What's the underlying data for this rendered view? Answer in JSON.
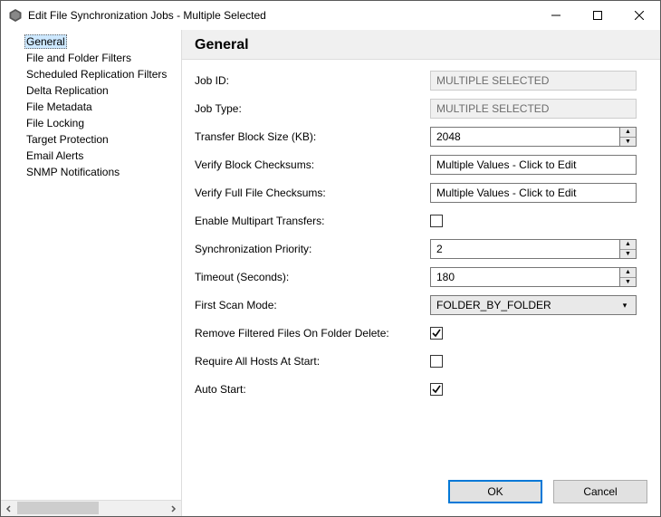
{
  "window": {
    "title": "Edit File Synchronization Jobs - Multiple Selected"
  },
  "sidebar": {
    "items": [
      {
        "label": "General",
        "selected": true
      },
      {
        "label": "File and Folder Filters",
        "selected": false
      },
      {
        "label": "Scheduled Replication Filters",
        "selected": false
      },
      {
        "label": "Delta Replication",
        "selected": false
      },
      {
        "label": "File Metadata",
        "selected": false
      },
      {
        "label": "File Locking",
        "selected": false
      },
      {
        "label": "Target Protection",
        "selected": false
      },
      {
        "label": "Email Alerts",
        "selected": false
      },
      {
        "label": "SNMP Notifications",
        "selected": false
      }
    ]
  },
  "main": {
    "heading": "General",
    "labels": {
      "job_id": "Job ID:",
      "job_type": "Job Type:",
      "transfer_block": "Transfer Block Size (KB):",
      "verify_block": "Verify Block Checksums:",
      "verify_full": "Verify Full File Checksums:",
      "enable_multipart": "Enable Multipart Transfers:",
      "sync_priority": "Synchronization Priority:",
      "timeout": "Timeout (Seconds):",
      "first_scan": "First Scan Mode:",
      "remove_filtered": "Remove Filtered Files On Folder Delete:",
      "require_hosts": "Require All Hosts At Start:",
      "auto_start": "Auto Start:"
    },
    "values": {
      "job_id": "MULTIPLE SELECTED",
      "job_type": "MULTIPLE SELECTED",
      "transfer_block": "2048",
      "verify_block": "Multiple Values - Click to Edit",
      "verify_full": "Multiple Values - Click to Edit",
      "enable_multipart": false,
      "sync_priority": "2",
      "timeout": "180",
      "first_scan": "FOLDER_BY_FOLDER",
      "remove_filtered": true,
      "require_hosts": false,
      "auto_start": true
    }
  },
  "footer": {
    "ok": "OK",
    "cancel": "Cancel"
  }
}
